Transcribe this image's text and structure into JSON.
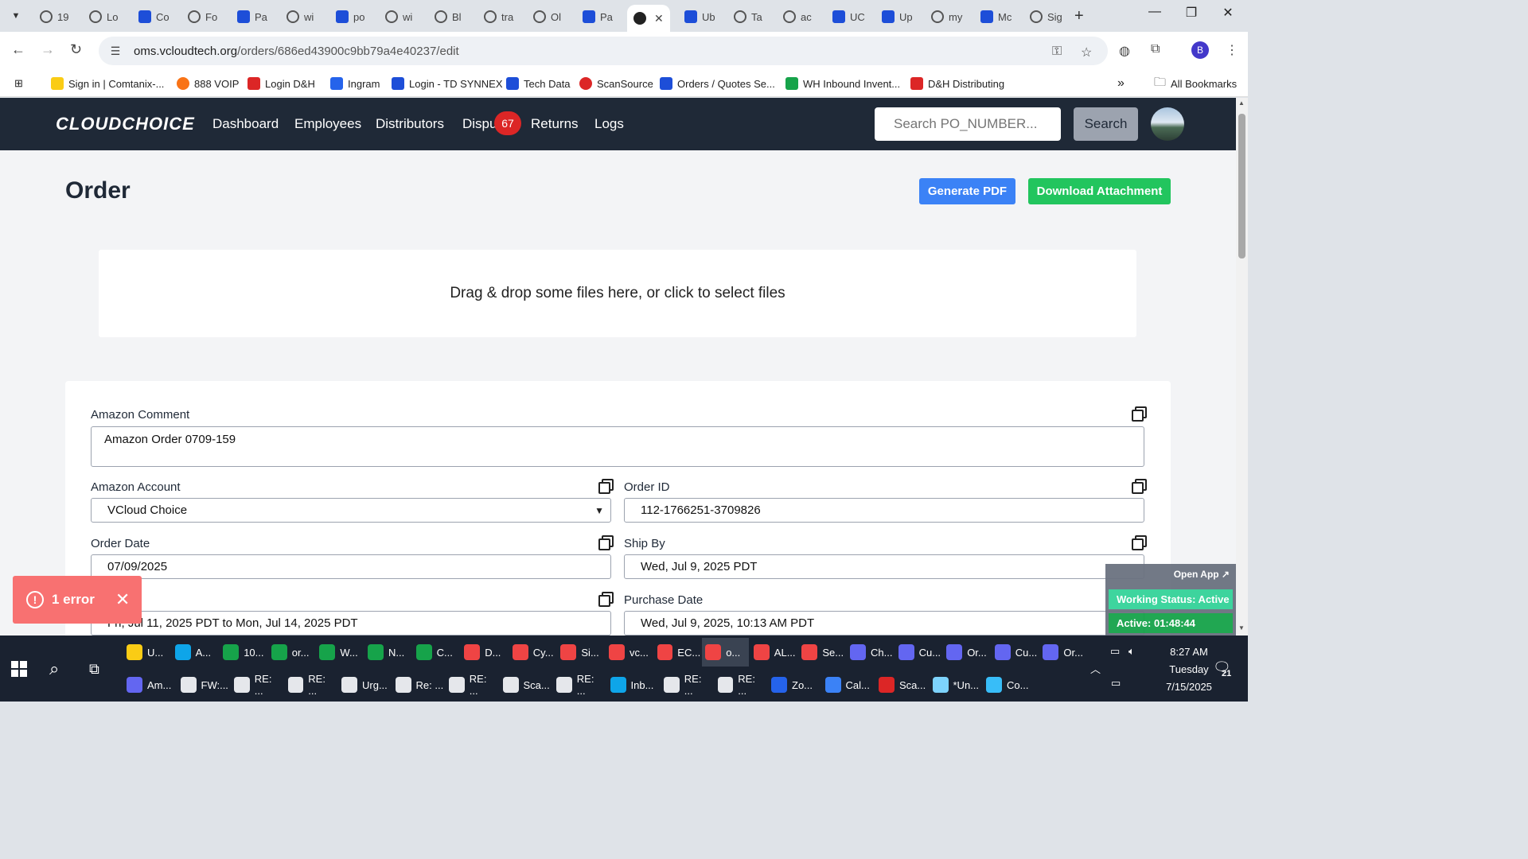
{
  "browser": {
    "tabs": [
      {
        "label": "19"
      },
      {
        "label": "Lo"
      },
      {
        "label": "Co"
      },
      {
        "label": "Fo"
      },
      {
        "label": "Pa"
      },
      {
        "label": "wi"
      },
      {
        "label": "po"
      },
      {
        "label": "wi"
      },
      {
        "label": "Bl"
      },
      {
        "label": "tra"
      },
      {
        "label": "Ol"
      },
      {
        "label": "Pa"
      },
      {
        "label": ""
      },
      {
        "label": "Ub"
      },
      {
        "label": "Ta"
      },
      {
        "label": "ac"
      },
      {
        "label": "UC"
      },
      {
        "label": "Up"
      },
      {
        "label": "my"
      },
      {
        "label": "Mc"
      },
      {
        "label": "Sig"
      }
    ],
    "url_host": "oms.vcloudtech.org",
    "url_path": "/orders/686ed43900c9bb79a4e40237/edit",
    "profile_initial": "B",
    "bookmarks": [
      {
        "label": "Sign in | Comtanix-...",
        "color": "#facc15"
      },
      {
        "label": "888 VOIP",
        "color": "#f97316"
      },
      {
        "label": "Login D&H",
        "color": "#dc2626"
      },
      {
        "label": "Ingram",
        "color": "#2563eb"
      },
      {
        "label": "Login - TD SYNNEX",
        "color": "#1d4ed8"
      },
      {
        "label": "Tech Data",
        "color": "#1d4ed8"
      },
      {
        "label": "ScanSource",
        "color": "#dc2626"
      },
      {
        "label": "Orders / Quotes Se...",
        "color": "#1d4ed8"
      },
      {
        "label": "WH Inbound Invent...",
        "color": "#16a34a"
      },
      {
        "label": "D&H Distributing",
        "color": "#dc2626"
      }
    ],
    "all_bookmarks": "All Bookmarks",
    "more_bookmarks": "»"
  },
  "app": {
    "logo": "CLOUDCHOICE",
    "nav": {
      "dashboard": "Dashboard",
      "employees": "Employees",
      "distributors": "Distributors",
      "disputes": "Dispu",
      "disputes_badge": "67",
      "returns": "Returns",
      "logs": "Logs"
    },
    "search": {
      "placeholder": "Search PO_NUMBER...",
      "button": "Search"
    }
  },
  "page": {
    "title": "Order",
    "generate_pdf": "Generate PDF",
    "download_attachment": "Download Attachment",
    "dropzone": "Drag & drop some files here, or click to select files",
    "fields": {
      "amazon_comment_label": "Amazon Comment",
      "amazon_comment_value": "Amazon Order 0709-159",
      "amazon_account_label": "Amazon Account",
      "amazon_account_value": "VCloud Choice",
      "order_id_label": "Order ID",
      "order_id_value": "112-1766251-3709826",
      "order_date_label": "Order Date",
      "order_date_value": "07/09/2025",
      "ship_by_label": "Ship By",
      "ship_by_value": "Wed, Jul 9, 2025 PDT",
      "delivery_value": "Fri, Jul 11, 2025 PDT to Mon, Jul 14, 2025 PDT",
      "purchase_date_label": "Purchase Date",
      "purchase_date_value": "Wed, Jul 9, 2025, 10:13 AM PDT"
    }
  },
  "toast": {
    "text": "1 error",
    "icon": "!",
    "close": "✕"
  },
  "work_status": {
    "open_app": "Open App ↗",
    "status": "Working Status: Active",
    "active_timer": "Active: 01:48:44"
  },
  "taskbar": {
    "row1": [
      "U...",
      "A...",
      "10...",
      "or...",
      "W...",
      "N...",
      "C...",
      "D...",
      "Cy...",
      "Si...",
      "vc...",
      "EC...",
      "o...",
      "AL...",
      "Se...",
      "Ch...",
      "Cu...",
      "Or...",
      "Cu...",
      "Or..."
    ],
    "row2": [
      "Am...",
      "FW:...",
      "RE: ...",
      "RE: ...",
      "Urg...",
      "Re: ...",
      "RE: ...",
      "Sca...",
      "RE: ...",
      "Inb...",
      "RE: ...",
      "RE: ...",
      "Zo...",
      "Cal...",
      "Sca...",
      "*Un...",
      "Co..."
    ],
    "time": "8:27 AM",
    "day": "Tuesday",
    "date": "7/15/2025",
    "notifications": "21"
  }
}
